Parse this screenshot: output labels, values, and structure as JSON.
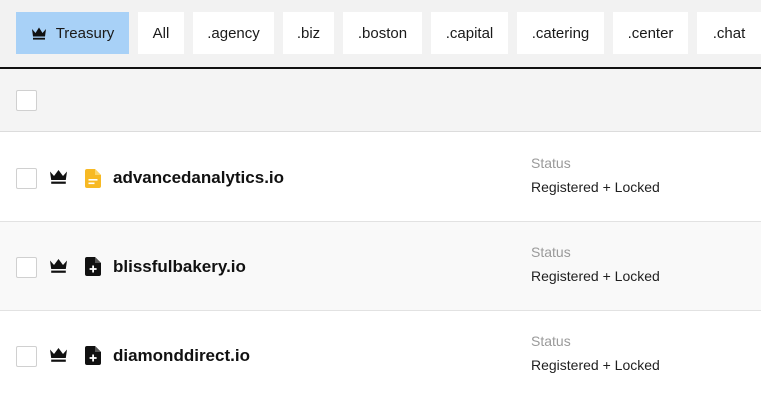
{
  "filters": [
    {
      "label": "Treasury",
      "active": true,
      "icon": "crown-icon"
    },
    {
      "label": "All",
      "active": false
    },
    {
      "label": ".agency",
      "active": false
    },
    {
      "label": ".biz",
      "active": false
    },
    {
      "label": ".boston",
      "active": false
    },
    {
      "label": ".capital",
      "active": false
    },
    {
      "label": ".catering",
      "active": false
    },
    {
      "label": ".center",
      "active": false
    },
    {
      "label": ".chat",
      "active": false
    }
  ],
  "colors": {
    "active_chip": "#a8d1f7",
    "file_icon_highlight": "#f7b924",
    "file_icon_default": "#111111"
  },
  "rows": [
    {
      "domain": "advancedanalytics.io",
      "status_label": "Status",
      "status_value": "Registered + Locked",
      "file_icon": "file-text-icon"
    },
    {
      "domain": "blissfulbakery.io",
      "status_label": "Status",
      "status_value": "Registered + Locked",
      "file_icon": "file-plus-icon"
    },
    {
      "domain": "diamonddirect.io",
      "status_label": "Status",
      "status_value": "Registered + Locked",
      "file_icon": "file-plus-icon"
    }
  ]
}
